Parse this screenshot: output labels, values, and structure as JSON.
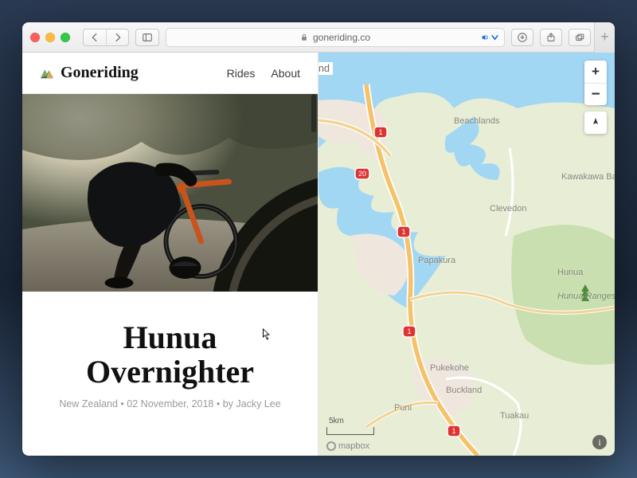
{
  "browser": {
    "domain": "goneriding.co",
    "sound_icon": "speaker-icon"
  },
  "site": {
    "brand": "Goneriding",
    "nav": {
      "rides": "Rides",
      "about": "About"
    },
    "article": {
      "title": "Hunua Overnighter",
      "meta": "New Zealand • 02 November, 2018 • by Jacky Lee"
    },
    "peek_label": "nd"
  },
  "map": {
    "zoom_in": "+",
    "zoom_out": "−",
    "compass": "compass-icon",
    "scale": "5km",
    "attribution": "mapbox",
    "labels": {
      "beachlands": "Beachlands",
      "kawakawa": "Kawakawa Bay",
      "clevedon": "Clevedon",
      "papakura": "Papakura",
      "hunua": "Hunua",
      "hunua_ranges": "Hunua Ranges",
      "pukekohe": "Pukekohe",
      "buckland": "Buckland",
      "puni": "Puni",
      "tuakau": "Tuakau"
    },
    "shields": {
      "s1": "1",
      "s20": "20"
    }
  }
}
